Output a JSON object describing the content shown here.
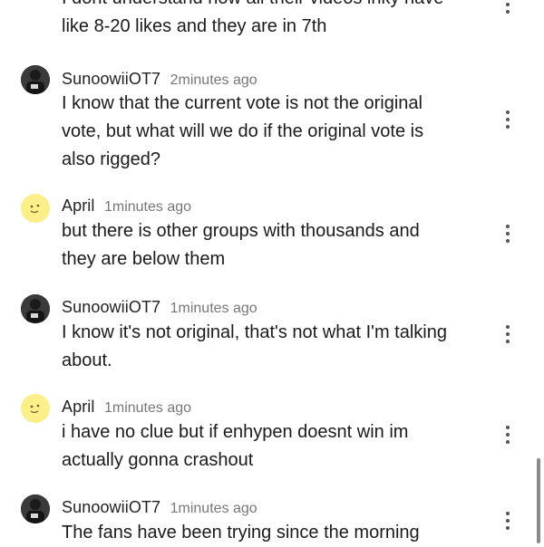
{
  "comments": [
    {
      "username": "",
      "time": "",
      "lines": [
        "I dont understand how all their videos inky have",
        "like 8-20 likes and they are in 7th"
      ]
    },
    {
      "username": "SunoowiiOT7",
      "time": "2minutes ago",
      "avatar": "user-photo-avatar",
      "lines": [
        "I know that the current vote is not the original",
        "vote, but what will we do if the original vote is",
        "also rigged?"
      ]
    },
    {
      "username": "April",
      "time": "1minutes ago",
      "avatar": "smiley-emoji-avatar",
      "lines": [
        "but there is other groups with thousands and",
        "they are below them"
      ]
    },
    {
      "username": "SunoowiiOT7",
      "time": "1minutes ago",
      "avatar": "user-photo-avatar",
      "lines": [
        "I know it's not original, that's not what I'm talking",
        "about."
      ]
    },
    {
      "username": "April",
      "time": "1minutes ago",
      "avatar": "smiley-emoji-avatar",
      "lines": [
        "i have no clue but if enhypen doesnt win im",
        "actually gonna crashout"
      ]
    },
    {
      "username": "SunoowiiOT7",
      "time": "1minutes ago",
      "avatar": "user-photo-avatar",
      "lines": [
        "The fans have been trying since the morning"
      ]
    }
  ],
  "icons": {
    "more": "kebab-menu-icon"
  },
  "colors": {
    "username": "#222222",
    "timestamp": "#777777",
    "emoji_avatar": "#fbef8a"
  }
}
